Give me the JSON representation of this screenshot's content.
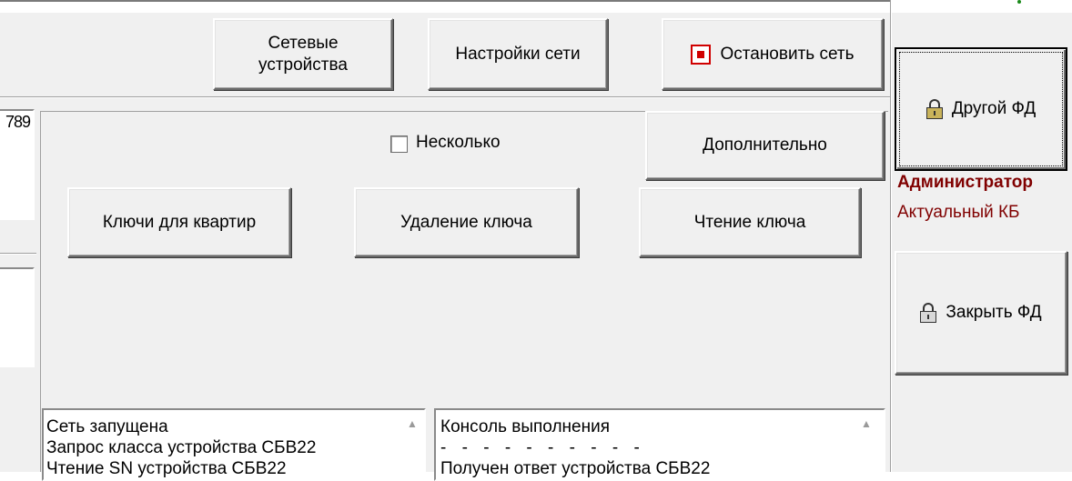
{
  "toolbar": {
    "network_devices": [
      "Сетевые",
      "устройства"
    ],
    "network_settings": "Настройки сети",
    "stop_network": "Остановить сеть"
  },
  "left_panel": {
    "clipped_text": "789"
  },
  "panel": {
    "several_label": "Несколько",
    "several_checked": false,
    "additional_button": "Дополнительно",
    "apartment_keys_button": "Ключи для квартир",
    "delete_key_button": "Удаление ключа",
    "read_key_button": "Чтение ключа"
  },
  "log_left": {
    "lines": [
      "Сеть запущена",
      "Запрос класса устройства СБВ22",
      "Чтение SN устройства СБВ22"
    ]
  },
  "log_right": {
    "lines": [
      "Консоль выполнения",
      "- - - - - - - - - -",
      "Получен ответ устройства СБВ22"
    ]
  },
  "side": {
    "other_fd_button": "Другой ФД",
    "role": "Администратор",
    "kb_status": "Актуальный КБ",
    "close_fd_button": "Закрыть ФД",
    "role_color": "#800000"
  }
}
